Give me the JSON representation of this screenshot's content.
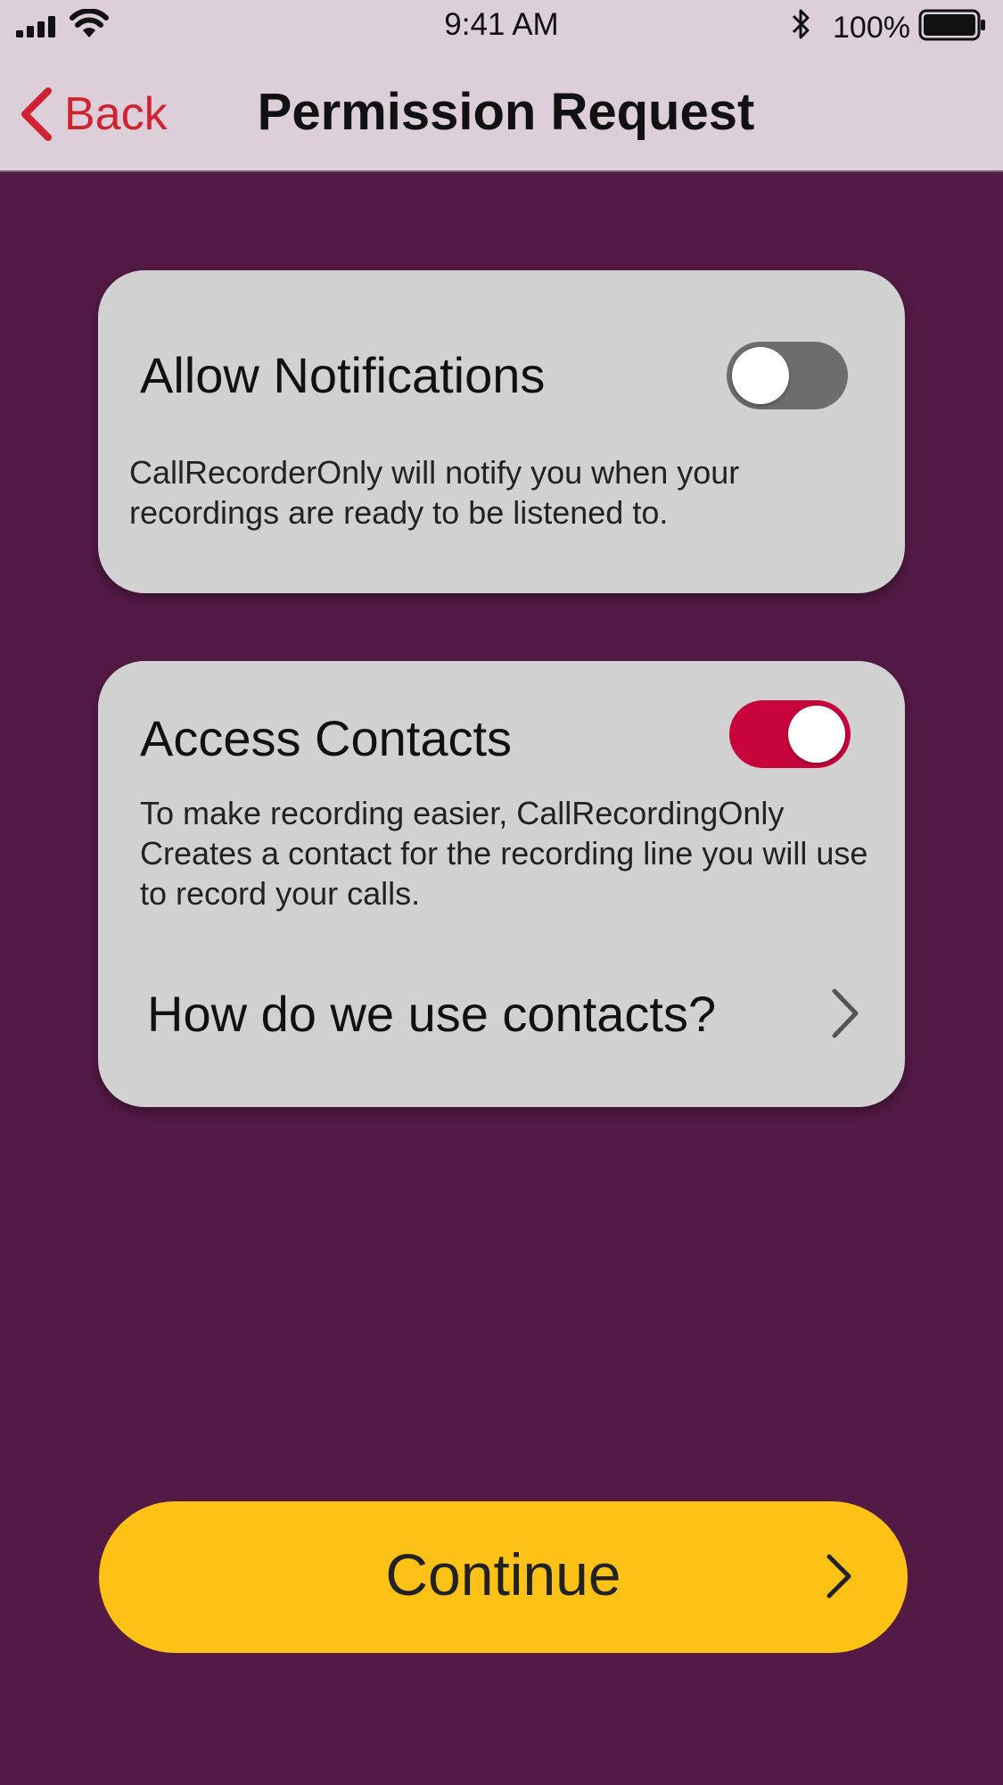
{
  "status_bar": {
    "time": "9:41 AM",
    "battery_percent": "100%",
    "icons": [
      "cellular-signal-icon",
      "wifi-icon",
      "bluetooth-icon",
      "battery-icon"
    ]
  },
  "nav": {
    "back_label": "Back",
    "title": "Permission Request"
  },
  "permissions": {
    "notifications": {
      "title": "Allow Notifications",
      "description": "CallRecorderOnly will notify you when your recordings are ready to be listened to.",
      "enabled": false
    },
    "contacts": {
      "title": "Access Contacts",
      "description": "To make recording easier, CallRecordingOnly Creates a contact for the recording line you will use to record your calls.",
      "enabled": true,
      "link_label": "How do we use contacts?"
    }
  },
  "continue_label": "Continue",
  "colors": {
    "background": "#541a46",
    "header": "#dccfd9",
    "card": "#d1d1d1",
    "accent_red": "#c8043c",
    "back_red": "#d02331",
    "toggle_off": "#6d6d6d",
    "button_yellow": "#fdc215"
  }
}
